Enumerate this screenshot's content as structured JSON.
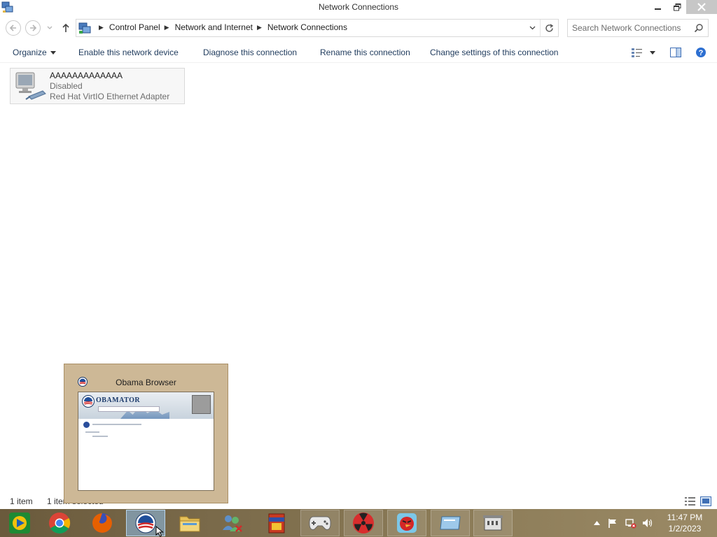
{
  "window": {
    "title": "Network Connections",
    "controls": {
      "minimize": "minimize",
      "restore": "restore",
      "close": "close"
    }
  },
  "nav": {
    "back": "back",
    "forward": "forward",
    "breadcrumbs": [
      "Control Panel",
      "Network and Internet",
      "Network Connections"
    ],
    "search_placeholder": "Search Network Connections"
  },
  "commands": {
    "organize": "Organize",
    "enable": "Enable this network device",
    "diagnose": "Diagnose this connection",
    "rename": "Rename this connection",
    "change": "Change settings of this connection"
  },
  "connection": {
    "name": "AAAAAAAAAAAAA",
    "status": "Disabled",
    "adapter": "Red Hat VirtIO Ethernet Adapter"
  },
  "status_bar": {
    "count": "1 item",
    "selected": "1 item selected"
  },
  "thumbnail": {
    "title": "Obama Browser",
    "brand": "OBAMATOR"
  },
  "taskbar": {
    "apps": [
      {
        "name": "media-player-icon",
        "state": "normal"
      },
      {
        "name": "chrome-icon",
        "state": "normal"
      },
      {
        "name": "firefox-icon",
        "state": "normal"
      },
      {
        "name": "obama-browser-icon",
        "state": "active"
      },
      {
        "name": "file-explorer-icon",
        "state": "normal"
      },
      {
        "name": "users-icon",
        "state": "normal"
      },
      {
        "name": "book-icon",
        "state": "normal"
      },
      {
        "name": "gamepad-icon",
        "state": "pinned"
      },
      {
        "name": "radiation-icon",
        "state": "pinned"
      },
      {
        "name": "angry-birds-icon",
        "state": "pinned"
      },
      {
        "name": "window-app-icon",
        "state": "pinned"
      },
      {
        "name": "building-icon",
        "state": "pinned"
      }
    ],
    "clock_time": "11:47 PM",
    "clock_date": "1/2/2023"
  },
  "colors": {
    "accent": "#1e3a5c",
    "taskbar": "#7a6a4a",
    "thumbnail_bg": "#cdb896",
    "close_button": "#c7c7c7"
  }
}
